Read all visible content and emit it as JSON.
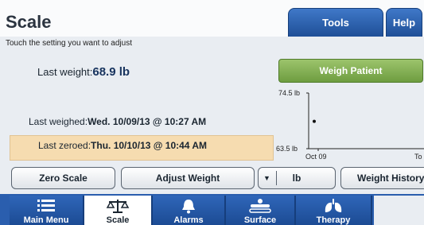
{
  "header": {
    "title": "Scale",
    "tabs": [
      "Tools",
      "Help"
    ]
  },
  "hint": "Touch the setting you want to adjust",
  "last_weight": {
    "label": "Last weight:",
    "value": "68.9 lb"
  },
  "last_weighed": {
    "label": "Last weighed:",
    "value": "Wed. 10/09/13 @ 10:27 AM"
  },
  "last_zeroed": {
    "label": "Last zeroed:",
    "value": "Thu. 10/10/13 @ 10:44 AM"
  },
  "weigh_button": "Weigh Patient",
  "chart_data": {
    "type": "scatter",
    "y_tick_labels": [
      "74.5 lb",
      "63.5 lb"
    ],
    "x_tick_labels": [
      "Oct 09",
      "To"
    ],
    "ylim": [
      63.5,
      74.5
    ],
    "points": [
      {
        "x": "Oct 09",
        "y": 68.9
      }
    ]
  },
  "buttons": {
    "zero": "Zero Scale",
    "adjust": "Adjust Weight",
    "unit": "lb",
    "history": "Weight History"
  },
  "nav": {
    "items": [
      {
        "label": "Main Menu",
        "icon": "menu-icon"
      },
      {
        "label": "Scale",
        "icon": "scale-icon"
      },
      {
        "label": "Alarms",
        "icon": "bell-icon"
      },
      {
        "label": "Surface",
        "icon": "surface-icon"
      },
      {
        "label": "Therapy",
        "icon": "lungs-icon"
      }
    ],
    "active": "Scale"
  },
  "colors": {
    "accent_blue": "#2a5eae",
    "weigh_green": "#7fac4f",
    "zero_highlight": "#f6dcb0"
  }
}
